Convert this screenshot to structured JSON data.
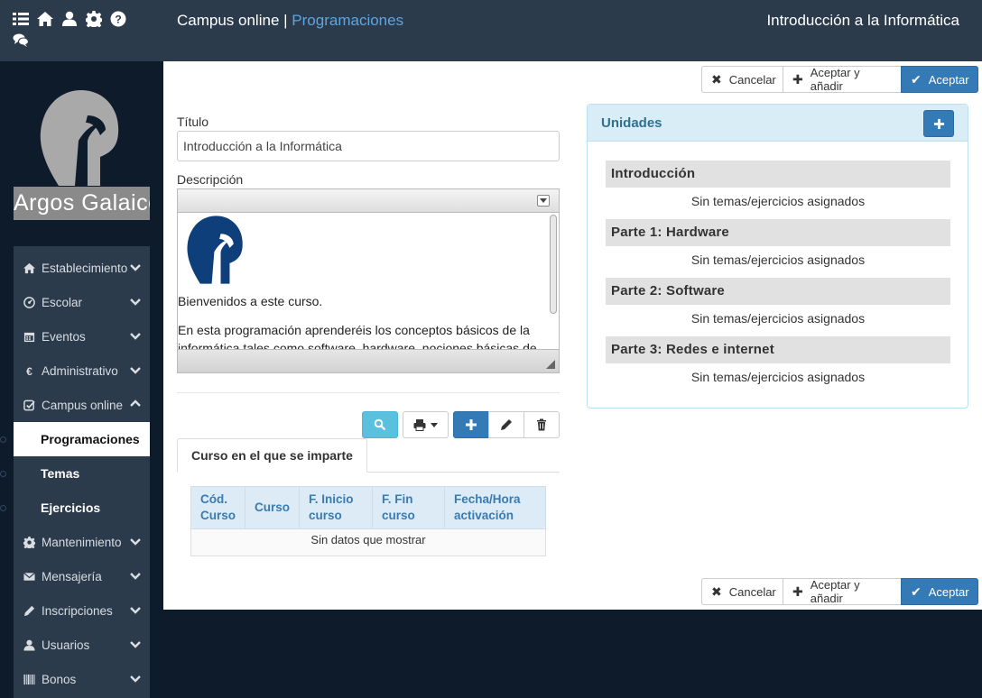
{
  "header": {
    "app_name": "Campus online",
    "separator": "|",
    "breadcrumb": "Programaciones",
    "page_title": "Introducción a la Informática",
    "icons": [
      "list-icon",
      "home-icon",
      "user-icon",
      "gear-icon",
      "help-icon",
      "chat-icon"
    ]
  },
  "sidebar": {
    "brand": "Argos Galaico",
    "items": [
      {
        "label": "Establecimiento",
        "icon": "home-icon"
      },
      {
        "label": "Escolar",
        "icon": "dashboard-icon"
      },
      {
        "label": "Eventos",
        "icon": "calendar-icon"
      },
      {
        "label": "Administrativo",
        "icon": "euro-icon"
      },
      {
        "label": "Campus online",
        "icon": "check-square-icon"
      },
      {
        "label": "Mantenimiento",
        "icon": "gear-icon"
      },
      {
        "label": "Mensajería",
        "icon": "envelope-icon"
      },
      {
        "label": "Inscripciones",
        "icon": "pencil-icon"
      },
      {
        "label": "Usuarios",
        "icon": "user-icon"
      },
      {
        "label": "Bonos",
        "icon": "barcode-icon"
      }
    ],
    "subitems": [
      {
        "label": "Programaciones",
        "active": true
      },
      {
        "label": "Temas",
        "active": false
      },
      {
        "label": "Ejercicios",
        "active": false
      }
    ]
  },
  "actions": {
    "cancel": "Cancelar",
    "accept_add": "Aceptar y añadir",
    "accept": "Aceptar"
  },
  "form": {
    "title_label": "Título",
    "title_value": "Introducción a la Informática",
    "description_label": "Descripción",
    "description_p1": "Bienvenidos a este curso.",
    "description_p2": "En esta programación aprenderéis los conceptos básicos de la informática tales como software, hardware, nociones básicas de"
  },
  "courses": {
    "tab_label": "Curso en el que se imparte",
    "columns": [
      "Cód. Curso",
      "Curso",
      "F. Inicio curso",
      "F. Fin curso",
      "Fecha/Hora activación"
    ],
    "empty": "Sin datos que mostrar"
  },
  "units": {
    "title": "Unidades",
    "items": [
      {
        "title": "Introducción",
        "empty": "Sin temas/ejercicios asignados"
      },
      {
        "title": "Parte 1: Hardware",
        "empty": "Sin temas/ejercicios asignados"
      },
      {
        "title": "Parte 2: Software",
        "empty": "Sin temas/ejercicios asignados"
      },
      {
        "title": "Parte 3: Redes e internet",
        "empty": "Sin temas/ejercicios asignados"
      }
    ]
  },
  "colors": {
    "topbar": "#2c3b4c",
    "primary": "#337ab7",
    "link": "#5aa6e0",
    "panel_info": "#d9edf7",
    "brand_logo": "#0e3f7a"
  }
}
